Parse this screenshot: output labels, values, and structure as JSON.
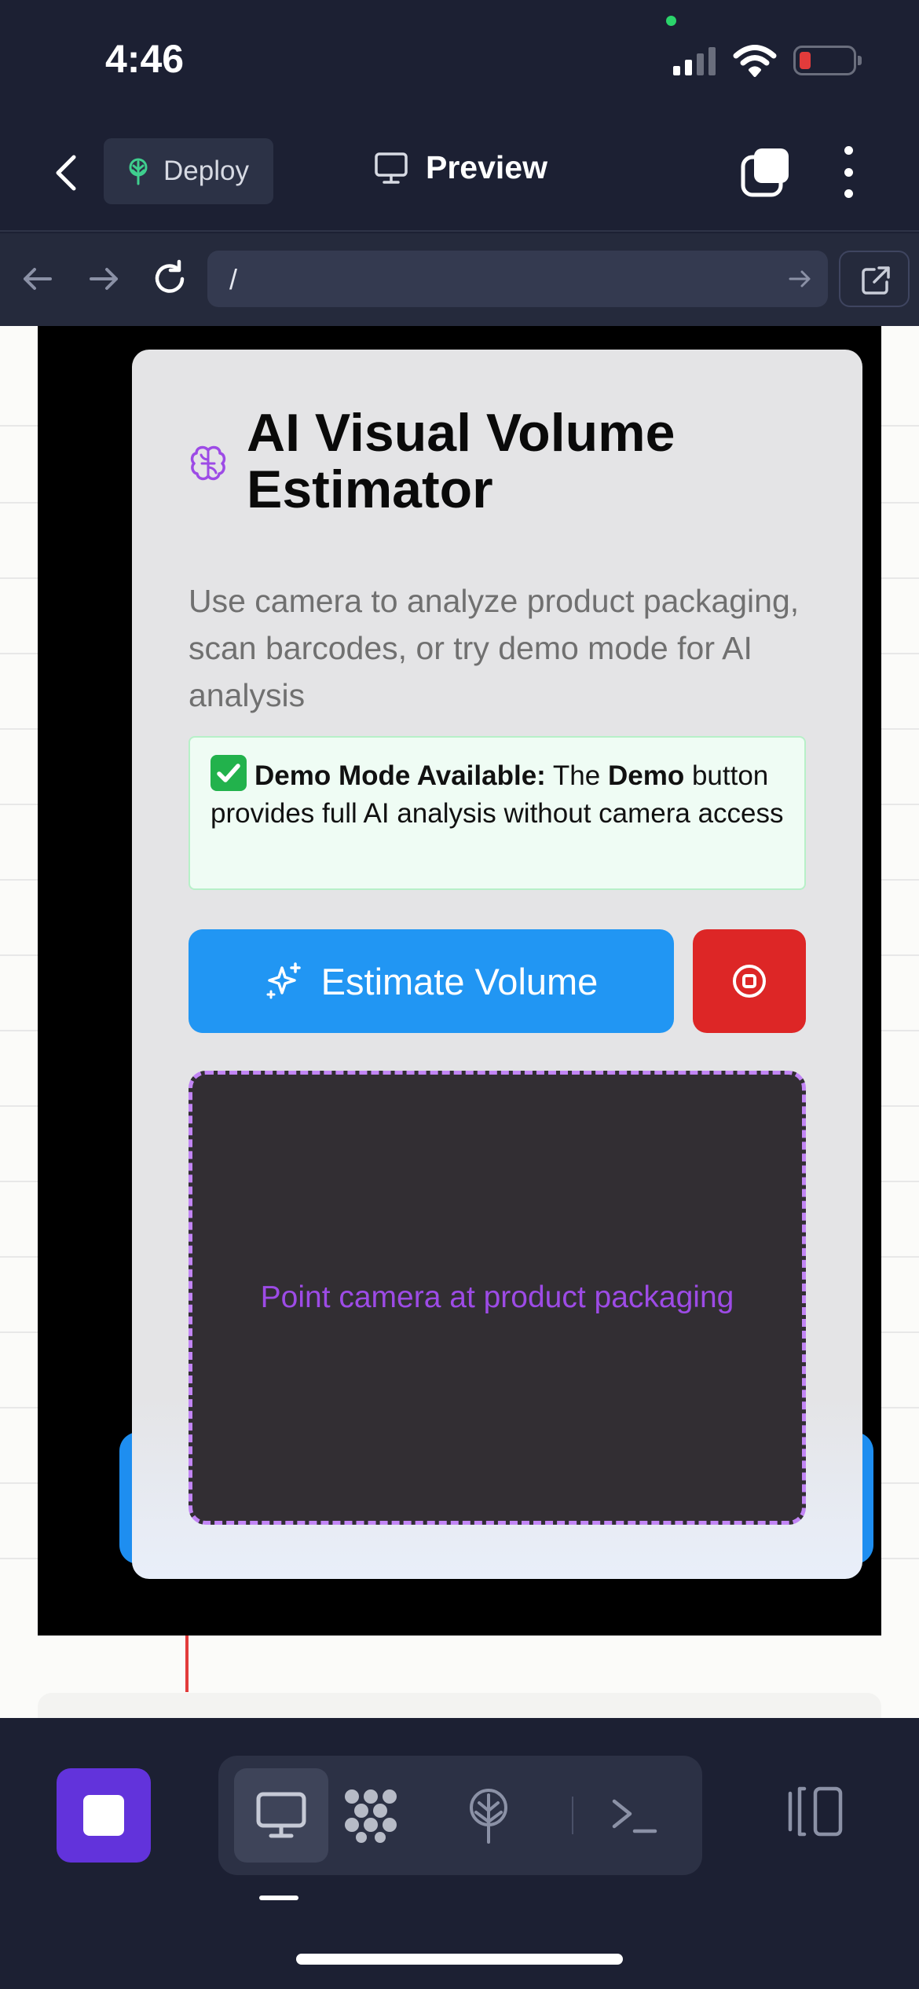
{
  "status_bar": {
    "time": "4:46"
  },
  "app_bar": {
    "deploy_label": "Deploy",
    "title": "Preview"
  },
  "url_bar": {
    "url": "/"
  },
  "app": {
    "title": "AI Visual Volume Estimator",
    "description": "Use camera to analyze product packaging, scan barcodes, or try demo mode for AI analysis",
    "notice": {
      "heading": "Demo Mode Available:",
      "text_pre": "The",
      "emphasis": "Demo",
      "text_post": "button provides full AI analysis without camera access"
    },
    "estimate_button": "Estimate Volume",
    "camera_hint": "Point camera at product packaging"
  },
  "colors": {
    "accent_blue": "#2196f3",
    "stop_red": "#dd2626",
    "camera_border": "#c285f5",
    "hint_purple": "#9d4be6",
    "brand_purple": "#6233db"
  },
  "icons": {
    "brain": "brain-icon",
    "sparkles": "sparkles-icon",
    "stop": "stop-circle-icon",
    "check": "check-emoji"
  }
}
